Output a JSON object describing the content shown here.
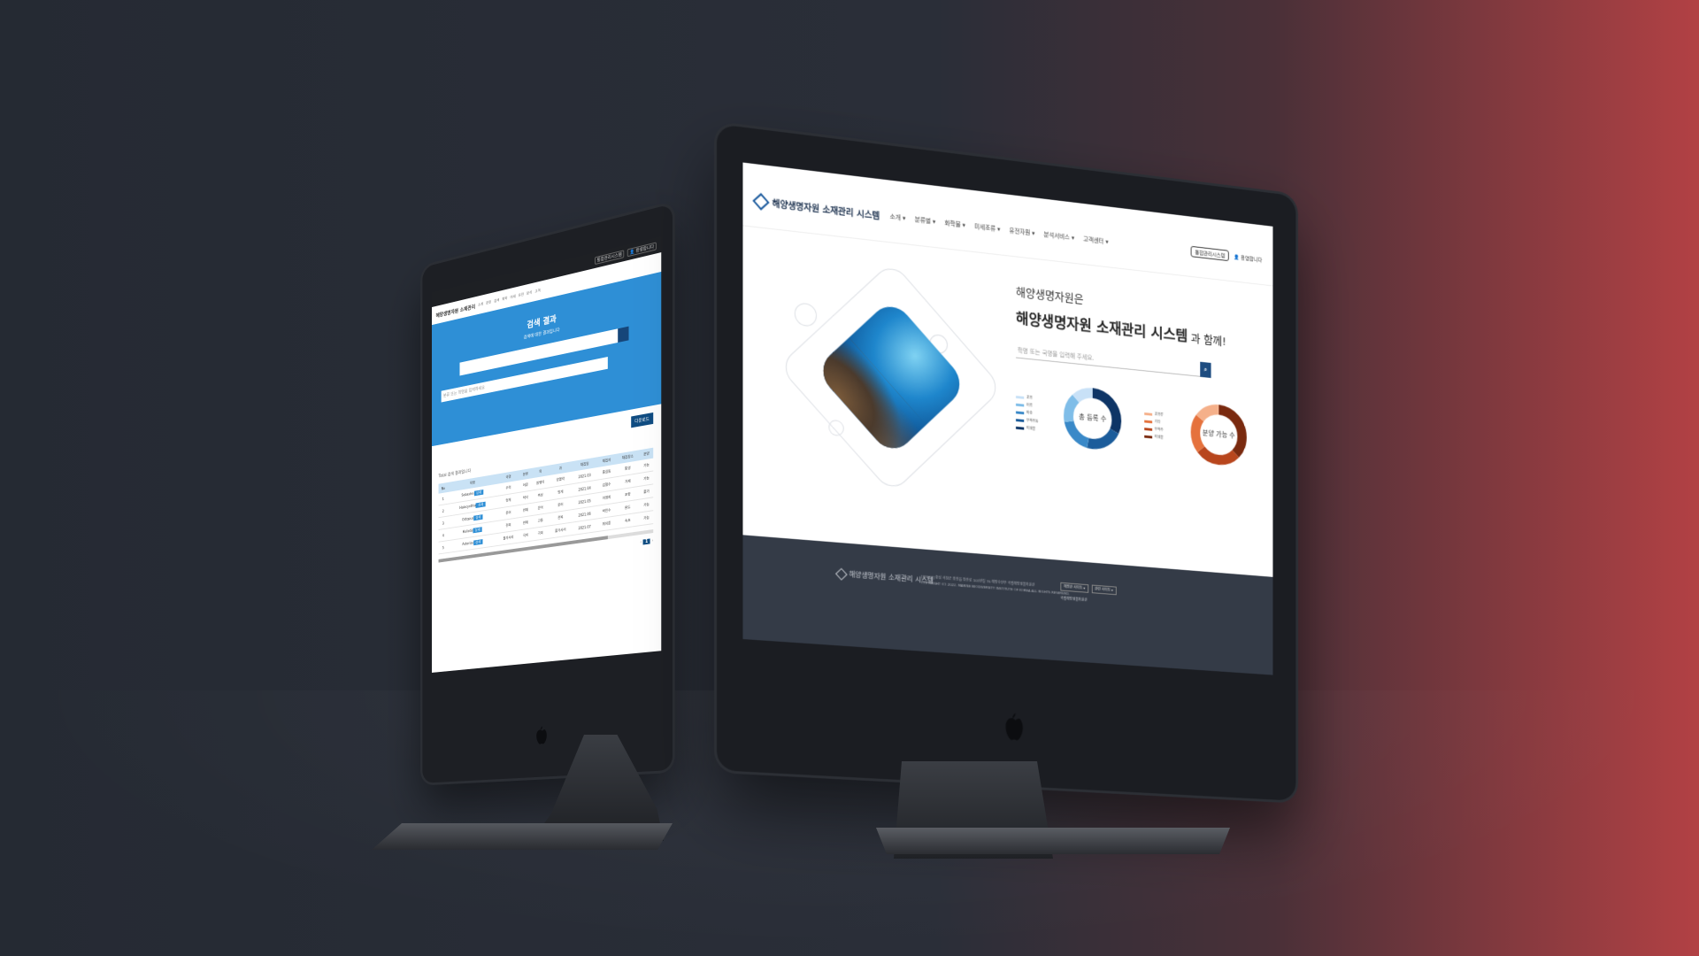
{
  "right_screen": {
    "header": {
      "logo_text": "해양생명자원 소재관리 시스템",
      "menu": [
        "소개 ▾",
        "분류별 ▾",
        "화학물 ▾",
        "미세조류 ▾",
        "유전자원 ▾",
        "분석서비스 ▾",
        "고객센터 ▾"
      ],
      "top_right": [
        "통합관리시스템",
        "👤 환영합니다"
      ]
    },
    "hero": {
      "line1": "해양생명자원은",
      "line2": "해양생명자원 소재관리 시스템",
      "line2_suffix": " 과 함께!",
      "search_placeholder": "학명 또는 국명을 입력해 주세요.",
      "search_icon": "search-icon"
    },
    "charts": {
      "donut1_label": "총 등록 수",
      "donut2_label": "분양 가능 수",
      "legend1": [
        "포유",
        "어류",
        "파충",
        "무척추동",
        "미생물"
      ],
      "legend2": [
        "포유류",
        "기타",
        "무척추",
        "미생물"
      ],
      "colors1": [
        "#c8e1f7",
        "#7fbde8",
        "#3a89c8",
        "#1b5c9b",
        "#0e3566"
      ],
      "colors2": [
        "#f5b08a",
        "#e5723d",
        "#b8461d",
        "#7a2a0f"
      ]
    },
    "footer": {
      "logo_text": "해양생명자원 소재관리 시스템",
      "address": "[33662] 충남 서천군 장항읍 장산로 101번길 75 해양수산부 국립해양생물자원관",
      "copyright": "COPYRIGHT (C) 2022. MARINE BIODIVERSITY INSTITUTE OF KOREA ALL RIGHTS RESERVED.",
      "btn1": "해양관 사이트 ▾",
      "btn2": "관련 사이트 ▾",
      "org": "국립해양생물자원관"
    }
  },
  "left_screen": {
    "top_right": [
      "통합관리시스템",
      "👤 환영합니다"
    ],
    "logo_text": "해양생명자원 소재관리",
    "nav": [
      "소개",
      "분류",
      "검색",
      "화학",
      "미세",
      "유전",
      "분석",
      "고객"
    ],
    "hero_title": "검색 결과",
    "hero_sub": "검색에 대한 결과입니다",
    "filter_placeholder": "분류 또는 학명을 입력하세요",
    "add_button": "다운로드",
    "count_text": "Total 검색 결과입니다",
    "table_headers": [
      "No",
      "학명",
      "국명",
      "분류",
      "목",
      "과",
      "채집일",
      "채집자",
      "채집장소",
      "분양"
    ],
    "rows": [
      [
        "1",
        "Sebastes",
        "우럭",
        "어류",
        "쏨뱅이",
        "양볼락",
        "2021.03",
        "홍길동",
        "통영",
        "가능"
      ],
      [
        "2",
        "Halocynthia",
        "멍게",
        "척삭",
        "측성",
        "멍게",
        "2021.04",
        "김철수",
        "거제",
        "가능"
      ],
      [
        "3",
        "Octopus",
        "문어",
        "연체",
        "문어",
        "문어",
        "2021.05",
        "이영희",
        "포항",
        "불가"
      ],
      [
        "4",
        "Haliotis",
        "전복",
        "연체",
        "고둥",
        "전복",
        "2021.06",
        "박민수",
        "완도",
        "가능"
      ],
      [
        "5",
        "Asterias",
        "불가사리",
        "극피",
        "극피",
        "불가사리",
        "2021.07",
        "최지훈",
        "속초",
        "가능"
      ]
    ],
    "chip": "상세",
    "pager": [
      "‹",
      "1",
      "›"
    ]
  }
}
